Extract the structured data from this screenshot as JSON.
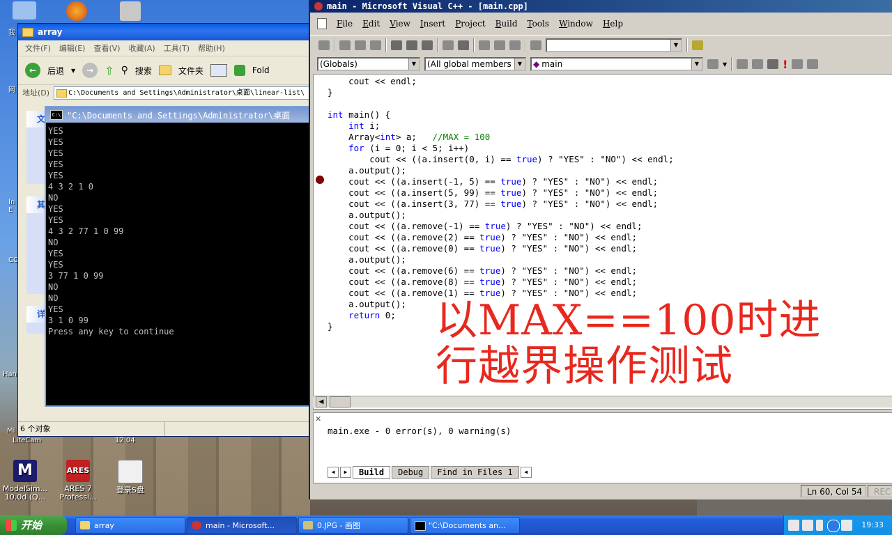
{
  "desktop": {
    "icons": [
      {
        "label": "ModelSim...\n10.0d (Q...",
        "color": "#1c1c6c"
      },
      {
        "label": "ARES 7\nProfessi...",
        "color": "#c02020"
      },
      {
        "label": "登录S盘",
        "color": "#f0f0f0"
      }
    ],
    "frags": [
      "我",
      "网",
      "In\nE",
      "CC",
      "Han",
      "Mi",
      "LiteCam",
      "12 04"
    ]
  },
  "explorer": {
    "title": "array",
    "menu": [
      "文件(F)",
      "编辑(E)",
      "查看(V)",
      "收藏(A)",
      "工具(T)",
      "帮助(H)"
    ],
    "toolbar": {
      "back": "后退",
      "search": "搜索",
      "folders": "文件夹",
      "extra": "Fold"
    },
    "address_label": "地址(D)",
    "address": "C:\\Documents and Settings\\Administrator\\桌面\\linear-list\\",
    "left_heads": [
      "文",
      "其",
      "详"
    ],
    "status": "6 个对象"
  },
  "console": {
    "title": "\"C:\\Documents and Settings\\Administrator\\桌面",
    "lines": [
      "YES",
      "YES",
      "YES",
      "YES",
      "YES",
      "4 3 2 1 0",
      "NO",
      "YES",
      "YES",
      "4 3 2 77 1 0 99",
      "NO",
      "YES",
      "YES",
      "3 77 1 0 99",
      "NO",
      "NO",
      "YES",
      "3 1 0 99",
      "Press any key to continue"
    ]
  },
  "vc": {
    "title": "main - Microsoft Visual C++ - [main.cpp]",
    "menu": [
      "File",
      "Edit",
      "View",
      "Insert",
      "Project",
      "Build",
      "Tools",
      "Window",
      "Help"
    ],
    "combo_globals": "(Globals)",
    "combo_members": "(All global members",
    "combo_main": "main",
    "overlay": "以MAX==100时进\n行越界操作测试",
    "output_text": "main.exe - 0 error(s), 0 warning(s)",
    "tabs": [
      "Build",
      "Debug",
      "Find in Files 1"
    ],
    "status_pos": "Ln 60, Col 54",
    "status_rec": "REC"
  },
  "code": [
    [
      [
        "    cout << endl;",
        ""
      ]
    ],
    [
      [
        "}",
        ""
      ]
    ],
    [
      [
        "",
        ""
      ]
    ],
    [
      [
        "int",
        "kw"
      ],
      [
        " main() {",
        ""
      ]
    ],
    [
      [
        "    ",
        ""
      ],
      [
        "int",
        "kw"
      ],
      [
        " i;",
        ""
      ]
    ],
    [
      [
        "    Array<",
        ""
      ],
      [
        "int",
        "kw"
      ],
      [
        "> a;   ",
        ""
      ],
      [
        "//MAX = 100",
        "cm"
      ]
    ],
    [
      [
        "    ",
        ""
      ],
      [
        "for",
        "kw"
      ],
      [
        " (i = 0; i < 5; i++)",
        ""
      ]
    ],
    [
      [
        "        cout << ((a.insert(0, i) == ",
        ""
      ],
      [
        "true",
        "kw"
      ],
      [
        ") ? \"YES\" : \"NO\") << endl;",
        ""
      ]
    ],
    [
      [
        "    a.output();",
        ""
      ]
    ],
    [
      [
        "    cout << ((a.insert(-1, 5) == ",
        ""
      ],
      [
        "true",
        "kw"
      ],
      [
        ") ? \"YES\" : \"NO\") << endl;",
        ""
      ]
    ],
    [
      [
        "    cout << ((a.insert(5, 99) == ",
        ""
      ],
      [
        "true",
        "kw"
      ],
      [
        ") ? \"YES\" : \"NO\") << endl;",
        ""
      ]
    ],
    [
      [
        "    cout << ((a.insert(3, 77) == ",
        ""
      ],
      [
        "true",
        "kw"
      ],
      [
        ") ? \"YES\" : \"NO\") << endl;",
        ""
      ]
    ],
    [
      [
        "    a.output();",
        ""
      ]
    ],
    [
      [
        "    cout << ((a.remove(-1) == ",
        ""
      ],
      [
        "true",
        "kw"
      ],
      [
        ") ? \"YES\" : \"NO\") << endl;",
        ""
      ]
    ],
    [
      [
        "    cout << ((a.remove(2) == ",
        ""
      ],
      [
        "true",
        "kw"
      ],
      [
        ") ? \"YES\" : \"NO\") << endl;",
        ""
      ]
    ],
    [
      [
        "    cout << ((a.remove(0) == ",
        ""
      ],
      [
        "true",
        "kw"
      ],
      [
        ") ? \"YES\" : \"NO\") << endl;",
        ""
      ]
    ],
    [
      [
        "    a.output();",
        ""
      ]
    ],
    [
      [
        "    cout << ((a.remove(6) == ",
        ""
      ],
      [
        "true",
        "kw"
      ],
      [
        ") ? \"YES\" : \"NO\") << endl;",
        ""
      ]
    ],
    [
      [
        "    cout << ((a.remove(8) == ",
        ""
      ],
      [
        "true",
        "kw"
      ],
      [
        ") ? \"YES\" : \"NO\") << endl;",
        ""
      ]
    ],
    [
      [
        "    cout << ((a.remove(1) == ",
        ""
      ],
      [
        "true",
        "kw"
      ],
      [
        ") ? \"YES\" : \"NO\") << endl;",
        ""
      ]
    ],
    [
      [
        "    a.output();",
        ""
      ]
    ],
    [
      [
        "    ",
        ""
      ],
      [
        "return",
        "kw"
      ],
      [
        " 0;",
        ""
      ]
    ],
    [
      [
        "}",
        ""
      ]
    ]
  ],
  "taskbar": {
    "start": "开始",
    "tasks": [
      {
        "label": "array",
        "active": false
      },
      {
        "label": "main - Microsoft...",
        "active": true
      },
      {
        "label": "0.JPG - 画图",
        "active": false
      },
      {
        "label": "\"C:\\Documents an...",
        "active": false
      }
    ],
    "clock": "19:33"
  }
}
